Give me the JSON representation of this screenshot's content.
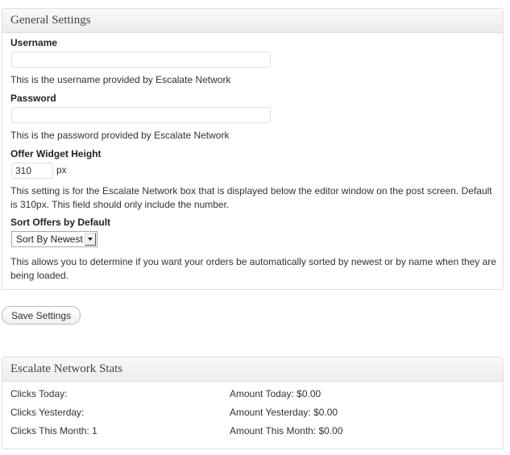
{
  "general": {
    "title": "General Settings",
    "username": {
      "label": "Username",
      "value": "",
      "description": "This is the username provided by Escalate Network"
    },
    "password": {
      "label": "Password",
      "value": "",
      "description": "This is the password provided by Escalate Network"
    },
    "widget_height": {
      "label": "Offer Widget Height",
      "value": "310",
      "unit": "px",
      "description_line1": "This setting is for the Escalate Network box that is displayed below the editor window on the post screen. Default",
      "description_line2": "is 310px. This field should only include the number."
    },
    "sort": {
      "label": "Sort Offers by Default",
      "selected": "Sort By Newest",
      "description_line1": "This allows you to determine if you want your orders be automatically sorted by newest or by name when they are",
      "description_line2": "being loaded."
    }
  },
  "save_label": "Save Settings",
  "stats": {
    "title": "Escalate Network Stats",
    "clicks_today": "Clicks Today:",
    "clicks_yesterday": "Clicks Yesterday:",
    "clicks_month": "Clicks This Month: 1",
    "amount_today": "Amount Today: $0.00",
    "amount_yesterday": "Amount Yesterday: $0.00",
    "amount_month": "Amount This Month: $0.00"
  }
}
